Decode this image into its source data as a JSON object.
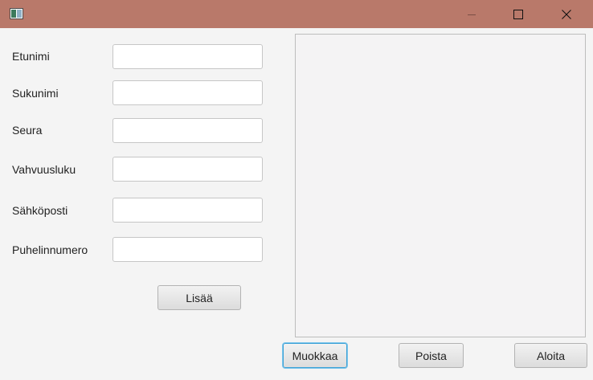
{
  "window": {
    "titlebar_color": "#b9796a",
    "controls": {
      "minimize_icon": "minimize-icon",
      "maximize_icon": "maximize-icon",
      "close_icon": "close-icon"
    }
  },
  "form": {
    "fields": [
      {
        "label": "Etunimi",
        "value": "",
        "placeholder": ""
      },
      {
        "label": "Sukunimi",
        "value": "",
        "placeholder": ""
      },
      {
        "label": "Seura",
        "value": "",
        "placeholder": ""
      },
      {
        "label": "Vahvuusluku",
        "value": "",
        "placeholder": ""
      },
      {
        "label": "Sähköposti",
        "value": "",
        "placeholder": ""
      },
      {
        "label": "Puhelinnumero",
        "value": "",
        "placeholder": ""
      }
    ],
    "add_button": "Lisää"
  },
  "list": {
    "items": []
  },
  "actions": {
    "edit_button": "Muokkaa",
    "delete_button": "Poista",
    "start_button": "Aloita"
  }
}
